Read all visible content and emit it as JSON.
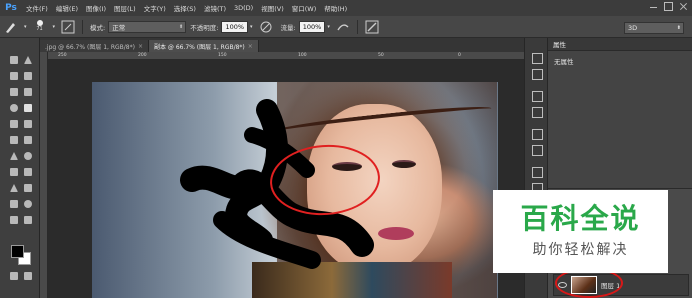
{
  "app": {
    "logo": "Ps"
  },
  "menubar": {
    "items": [
      "文件(F)",
      "编辑(E)",
      "图像(I)",
      "图层(L)",
      "文字(Y)",
      "选择(S)",
      "滤镜(T)",
      "3D(D)",
      "视图(V)",
      "窗口(W)",
      "帮助(H)"
    ]
  },
  "options": {
    "brush_size": "71",
    "mode_label": "模式:",
    "mode_value": "正常",
    "opacity_label": "不透明度:",
    "opacity_value": "100%",
    "flow_label": "流量:",
    "flow_value": "100%",
    "workspace_value": "3D"
  },
  "tabs": [
    {
      "label": ".jpg @ 66.7% (图层 1, RGB/8*)",
      "close": "×"
    },
    {
      "label": "副本 @ 66.7% (图层 1, RGB/8*)",
      "close": "×"
    }
  ],
  "ruler": {
    "ticks": [
      "250",
      "200",
      "150",
      "100",
      "50",
      "0"
    ]
  },
  "properties": {
    "title": "属性",
    "body": "无属性"
  },
  "layers": {
    "layer_name": "图层 1"
  },
  "watermark": {
    "title": "百科全说",
    "subtitle": "助你轻松解决"
  },
  "colors": {
    "foreground": "#000000",
    "background": "#ffffff",
    "annotation": "#e02020",
    "brand": "#2aa84a"
  }
}
